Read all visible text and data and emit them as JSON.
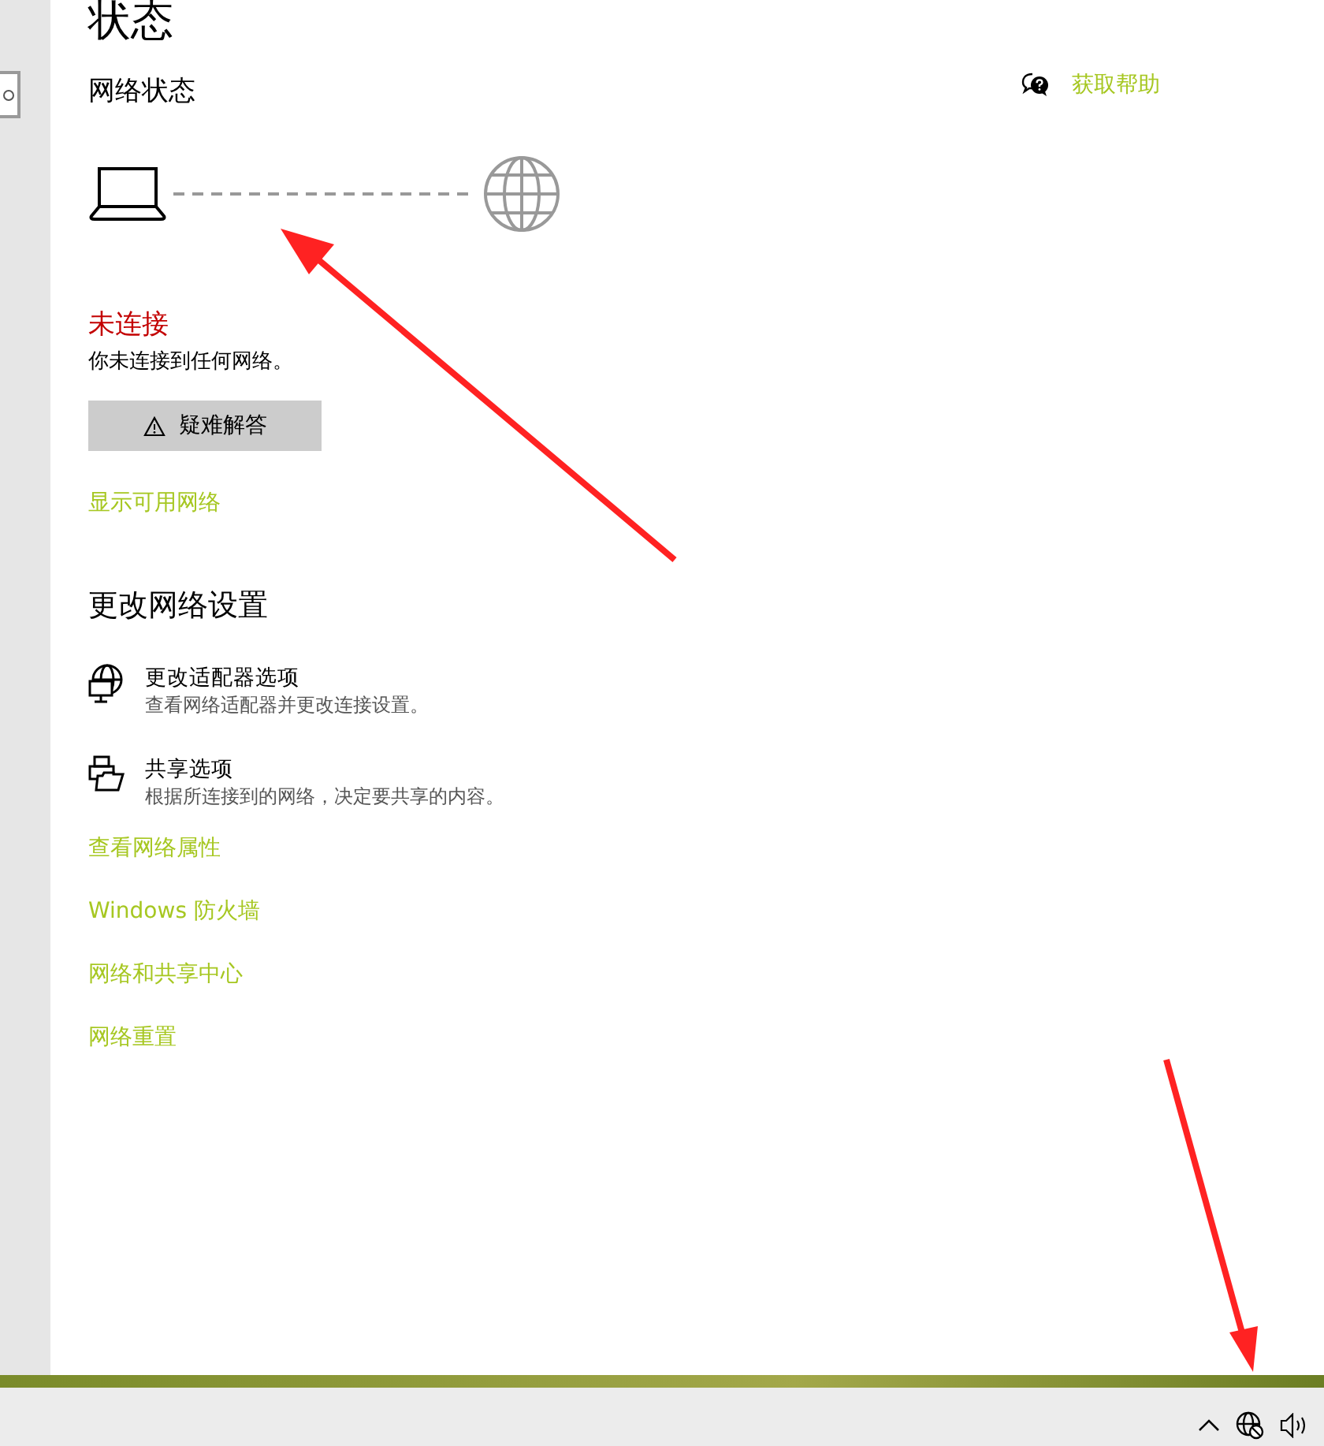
{
  "page": {
    "title": "状态"
  },
  "help_link": {
    "label": "获取帮助"
  },
  "network_status": {
    "heading": "网络状态",
    "connected": false,
    "status_text": "未连接",
    "description": "你未连接到任何网络。",
    "troubleshoot_button": "疑难解答",
    "show_networks_link": "显示可用网络"
  },
  "change_settings": {
    "heading": "更改网络设置",
    "options": [
      {
        "kind": "adapter",
        "title": "更改适配器选项",
        "description": "查看网络适配器并更改连接设置。"
      },
      {
        "kind": "sharing",
        "title": "共享选项",
        "description": "根据所连接到的网络，决定要共享的内容。"
      }
    ],
    "links": [
      "查看网络属性",
      "Windows 防火墙",
      "网络和共享中心",
      "网络重置"
    ]
  }
}
